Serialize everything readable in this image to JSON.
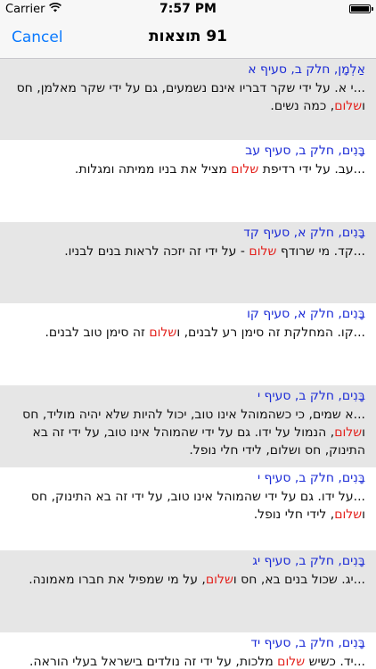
{
  "status_bar": {
    "carrier": "Carrier",
    "time": "7:57 PM"
  },
  "nav": {
    "cancel_label": "Cancel",
    "title": "91 תוצאות"
  },
  "colors": {
    "accent": "#0a79fe",
    "reference": "#1b2bd6",
    "highlight": "#e3201b",
    "row_gray": "#e6e6e6"
  },
  "results": [
    {
      "ref": "אַלְמָן, חלק ב, סעיף א",
      "segments": [
        {
          "t": "...י א. על ידי שקר דבריו אינם נשמעים, גם על ידי שקר מאלמן, חס ו",
          "h": false
        },
        {
          "t": "שלום",
          "h": true
        },
        {
          "t": ", כמה נשים.",
          "h": false
        }
      ]
    },
    {
      "ref": "בָּנִים, חלק ב, סעיף עב",
      "segments": [
        {
          "t": "...עב. על ידי רדיפת ",
          "h": false
        },
        {
          "t": "שלום",
          "h": true
        },
        {
          "t": " מציל את בניו ממיתה ומגלות.",
          "h": false
        }
      ]
    },
    {
      "ref": "בָּנִים, חלק א, סעיף קד",
      "segments": [
        {
          "t": "...קד. מי שרודף ",
          "h": false
        },
        {
          "t": "שלום",
          "h": true
        },
        {
          "t": " - על ידי זה יזכה לראות בנים לבניו.",
          "h": false
        }
      ]
    },
    {
      "ref": "בָּנִים, חלק א, סעיף קו",
      "segments": [
        {
          "t": "...קו. המחלקת זה סימן רע לבנים, ו",
          "h": false
        },
        {
          "t": "שלום",
          "h": true
        },
        {
          "t": " זה סימן טוב לבנים.",
          "h": false
        }
      ]
    },
    {
      "ref": "בָּנִים, חלק ב, סעיף י",
      "segments": [
        {
          "t": "...א שמים, כי כשהמוהל אינו טוב, יכול להיות שלא יהיה מוליד, חס ו",
          "h": false
        },
        {
          "t": "שלום",
          "h": true
        },
        {
          "t": ", הנמול על ידו. גם על ידי שהמוהל אינו טוב, על ידי זה בא התינוק, חס ושלום, לידי חלי נופל.",
          "h": false
        }
      ]
    },
    {
      "ref": "בָּנִים, חלק ב, סעיף י",
      "segments": [
        {
          "t": "...על ידו. גם על ידי שהמוהל אינו טוב, על ידי זה בא התינוק, חס ו",
          "h": false
        },
        {
          "t": "שלום",
          "h": true
        },
        {
          "t": ", לידי חלי נופל.",
          "h": false
        }
      ]
    },
    {
      "ref": "בָּנִים, חלק ב, סעיף יג",
      "segments": [
        {
          "t": "...יג. שכול בנים בא, חס ו",
          "h": false
        },
        {
          "t": "שלום",
          "h": true
        },
        {
          "t": ", על מי שמפיל את חברו מאמונה.",
          "h": false
        }
      ]
    },
    {
      "ref": "בָּנִים, חלק ב, סעיף יד",
      "segments": [
        {
          "t": "...יד. כשיש ",
          "h": false
        },
        {
          "t": "שלום",
          "h": true
        },
        {
          "t": " מלכות, על ידי זה נולדים בישראל בעלי הוראה.",
          "h": false
        }
      ]
    }
  ]
}
